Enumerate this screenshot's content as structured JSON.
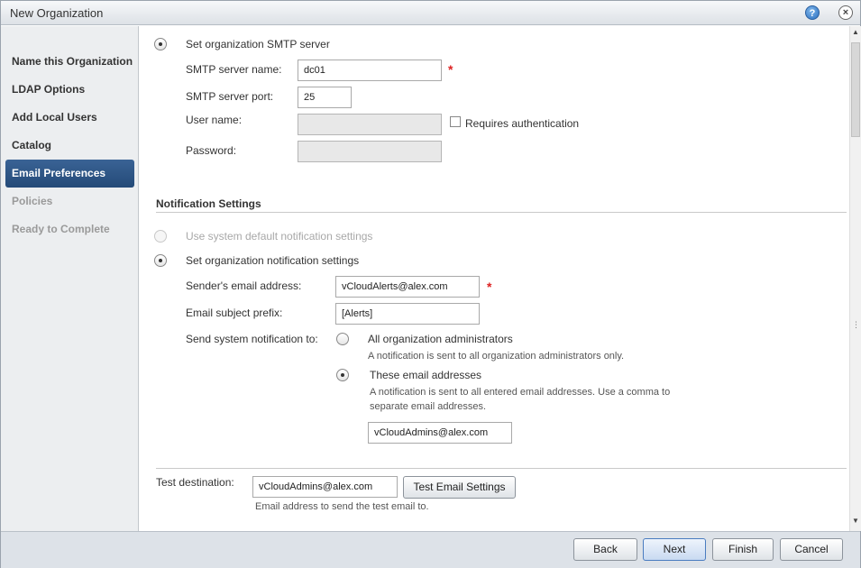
{
  "window": {
    "title": "New Organization",
    "help_glyph": "?",
    "close_glyph": "×"
  },
  "sidebar": {
    "items": [
      {
        "label": "Name this Organization",
        "state": "normal"
      },
      {
        "label": "LDAP Options",
        "state": "normal"
      },
      {
        "label": "Add Local Users",
        "state": "normal"
      },
      {
        "label": "Catalog",
        "state": "normal"
      },
      {
        "label": "Email Preferences",
        "state": "active"
      },
      {
        "label": "Policies",
        "state": "disabled"
      },
      {
        "label": "Ready to Complete",
        "state": "disabled"
      }
    ]
  },
  "smtp": {
    "option_label": "Set organization SMTP server",
    "server_name_label": "SMTP server name:",
    "server_name_value": "dc01",
    "server_port_label": "SMTP server port:",
    "server_port_value": "25",
    "username_label": "User name:",
    "username_value": "",
    "requires_auth_label": "Requires authentication",
    "password_label": "Password:",
    "password_value": ""
  },
  "notification": {
    "section_title": "Notification Settings",
    "use_default_label": "Use system default notification settings",
    "set_org_label": "Set organization notification settings",
    "sender_label": "Sender's email address:",
    "sender_value": "vCloudAlerts@alex.com",
    "subject_prefix_label": "Email subject prefix:",
    "subject_prefix_value": "[Alerts]",
    "send_to_label": "Send system notification to:",
    "all_admins_label": "All organization administrators",
    "all_admins_hint": "A notification is sent to all organization administrators only.",
    "these_addresses_label": "These email addresses",
    "these_addresses_hint_1": "A notification is sent to all entered email addresses. Use a comma to",
    "these_addresses_hint_2": "separate email addresses.",
    "addresses_value": "vCloudAdmins@alex.com"
  },
  "test": {
    "label": "Test destination:",
    "value": "vCloudAdmins@alex.com",
    "button_label": "Test Email Settings",
    "hint": "Email address to send the test email to."
  },
  "footer": {
    "back": "Back",
    "next": "Next",
    "finish": "Finish",
    "cancel": "Cancel"
  },
  "scrollbar": {
    "up_glyph": "▲",
    "down_glyph": "▼",
    "grip_glyph": "⋮⋮"
  }
}
